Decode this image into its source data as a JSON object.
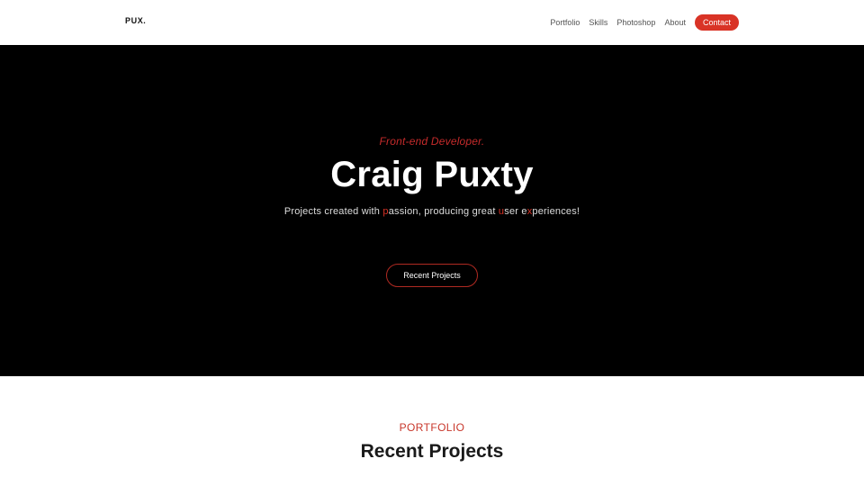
{
  "header": {
    "logo": "PUX.",
    "nav": [
      {
        "label": "Portfolio"
      },
      {
        "label": "Skills"
      },
      {
        "label": "Photoshop"
      },
      {
        "label": "About"
      }
    ],
    "contact_label": "Contact"
  },
  "hero": {
    "subtitle": "Front-end Developer.",
    "title": "Craig Puxty",
    "tagline": {
      "part1": "Projects created with ",
      "accent1": "p",
      "part2": "assion, producing great ",
      "accent2": "u",
      "part3": "ser e",
      "accent3": "x",
      "part4": "periences!"
    },
    "button_label": "Recent Projects"
  },
  "portfolio": {
    "eyebrow": "PORTFOLIO",
    "heading": "Recent Projects"
  },
  "colors": {
    "accent": "#d93326",
    "hero_bg": "#000000",
    "header_bg": "#ffffff"
  }
}
